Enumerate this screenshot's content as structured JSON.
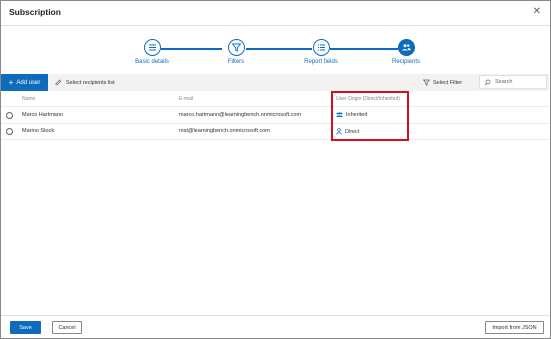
{
  "dialog": {
    "title": "Subscription",
    "close_icon": "close-icon"
  },
  "colors": {
    "accent": "#0f6cbd",
    "highlight": "#d40f1e"
  },
  "stepper": {
    "steps": [
      {
        "label": "Basic details",
        "icon": "list-icon",
        "state": "done"
      },
      {
        "label": "Filters",
        "icon": "filter-icon",
        "state": "done"
      },
      {
        "label": "Report fields",
        "icon": "list-icon",
        "state": "done"
      },
      {
        "label": "Recipients",
        "icon": "people-icon",
        "state": "current"
      }
    ]
  },
  "toolbar": {
    "add_user": "Add user",
    "select_recipients": "Select recipients list",
    "select_filter": "Select Filter",
    "search_placeholder": "Search"
  },
  "table": {
    "columns": [
      "Name",
      "E-mail",
      "User Origin (Direct/Inherited)"
    ],
    "rows": [
      {
        "name": "Marco Hartmann",
        "email": "marco.hartmann@learningbench.onmicrosoft.com",
        "origin": "Inherited",
        "origin_icon": "group-icon"
      },
      {
        "name": "Marino Stock",
        "email": "mst@learningbench.onmicrosoft.com",
        "origin": "Direct",
        "origin_icon": "person-icon"
      }
    ]
  },
  "footer": {
    "save": "Save",
    "cancel": "Cancel",
    "import_json": "Import from JSON"
  }
}
